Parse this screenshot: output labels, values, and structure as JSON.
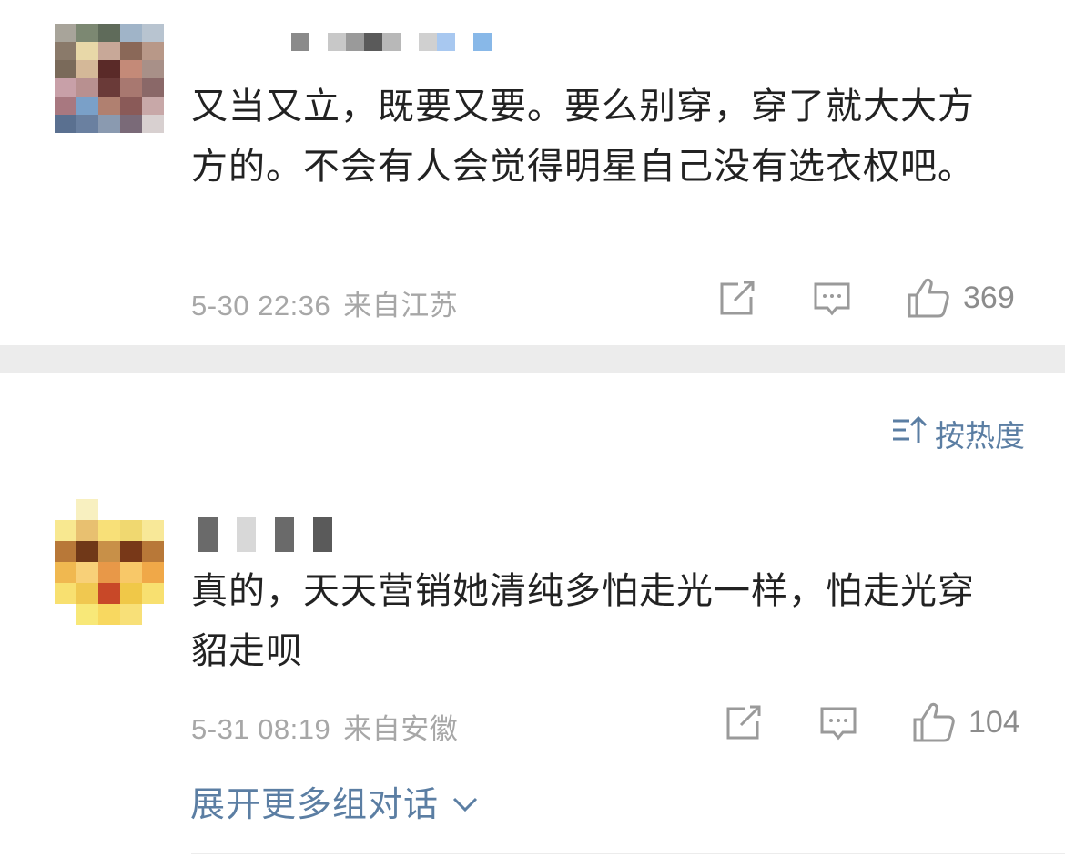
{
  "comments": [
    {
      "text": "又当又立，既要又要。要么别穿，穿了就大大方方的。不会有人会觉得明星自己没有选衣权吧。",
      "date": "5-30 22:36",
      "location": "来自江苏",
      "likes": "369",
      "avatar_colors": [
        [
          "#a8a49a",
          "#7c8872",
          "#5f6b5a",
          "#a0b4c8",
          "#b8c4d0"
        ],
        [
          "#8a7a6a",
          "#e8d8a8",
          "#c8a898",
          "#8a6858",
          "#b89888"
        ],
        [
          "#7a6a5a",
          "#d4b898",
          "#5a2a28",
          "#c48a78",
          "#a89088"
        ],
        [
          "#c8a0a8",
          "#b89090",
          "#6a3a38",
          "#a87870",
          "#8a6868"
        ],
        [
          "#a87880",
          "#7aa0c8",
          "#b08070",
          "#8a5a58",
          "#c8a8a8"
        ],
        [
          "#5a7090",
          "#6a80a0",
          "#8a9ab0",
          "#7a6a78",
          "#d8d0d0"
        ]
      ],
      "name_blocks": [
        "#8a8a8a",
        "#ffffff",
        "#c8c8c8",
        "#9a9a9a",
        "#5a5a5a",
        "#b8b8b8",
        "#ffffff",
        "#d0d0d0",
        "#a8c8f0",
        "#ffffff",
        "#88b8e8"
      ]
    },
    {
      "text": "真的，天天营销她清纯多怕走光一样，怕走光穿貂走呗",
      "date": "5-31 08:19",
      "location": "来自安徽",
      "likes": "104",
      "avatar_colors": [
        [
          "#ffffff",
          "#f8f0c0",
          "#ffffff",
          "#ffffff",
          "#ffffff"
        ],
        [
          "#f8e890",
          "#e8c070",
          "#f8e078",
          "#f0d870",
          "#f8e898"
        ],
        [
          "#b87838",
          "#703818",
          "#c89048",
          "#783818",
          "#b87838"
        ],
        [
          "#f0b850",
          "#f8d078",
          "#e89848",
          "#f8c868",
          "#f0a848"
        ],
        [
          "#f8e070",
          "#f0c850",
          "#c84828",
          "#f0c848",
          "#f8e070"
        ],
        [
          "#ffffff",
          "#f8e878",
          "#f8d860",
          "#f8e078",
          "#ffffff"
        ]
      ],
      "name_blocks": [
        "#6a6a6a",
        "#ffffff",
        "#d8d8d8",
        "#ffffff",
        "#6a6a6a",
        "#ffffff",
        "#5a5a5a"
      ]
    }
  ],
  "sort_label": "按热度",
  "expand_label": "展开更多组对话",
  "icons": {
    "share": "share-icon",
    "comment": "comment-icon",
    "like": "thumbs-up-icon",
    "sort": "sort-icon",
    "expand": "chevron-down-icon"
  },
  "colors": {
    "link_blue": "#5b7ea3",
    "meta_gray": "#a7a7a7",
    "divider": "#ececec"
  }
}
